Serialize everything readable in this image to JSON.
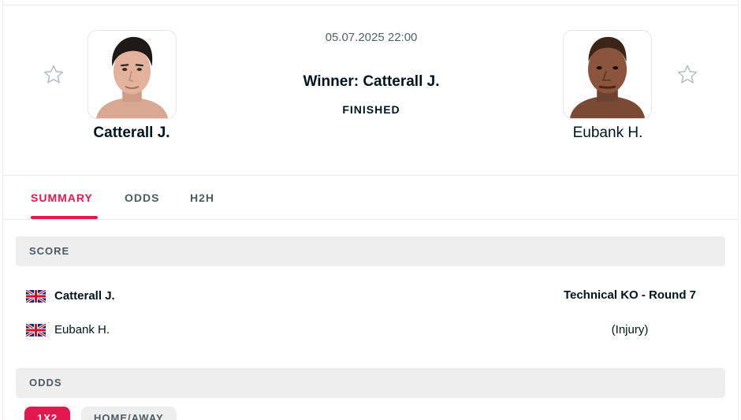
{
  "match": {
    "datetime": "05.07.2025 22:00",
    "winner_text": "Winner: Catterall J.",
    "status": "FINISHED"
  },
  "home": {
    "name": "Catterall J.",
    "avatar": "fighter-photo"
  },
  "away": {
    "name": "Eubank H.",
    "avatar": "fighter-photo"
  },
  "tabs": [
    {
      "label": "SUMMARY",
      "active": true
    },
    {
      "label": "ODDS",
      "active": false
    },
    {
      "label": "H2H",
      "active": false
    }
  ],
  "score": {
    "header": "SCORE",
    "rows": [
      {
        "flag": "gb-flag-icon",
        "name": "Catterall J.",
        "result": "Technical KO - Round 7"
      },
      {
        "flag": "gb-flag-icon",
        "name": "Eubank H.",
        "result": "(Injury)"
      }
    ]
  },
  "odds": {
    "header": "ODDS",
    "pills": [
      {
        "label": "1X2",
        "active": true
      },
      {
        "label": "HOME/AWAY",
        "active": false
      }
    ]
  },
  "colors": {
    "accent": "#e4174f",
    "text": "#00141e",
    "muted": "#4d5a61",
    "section_bg": "#eeeeee"
  }
}
